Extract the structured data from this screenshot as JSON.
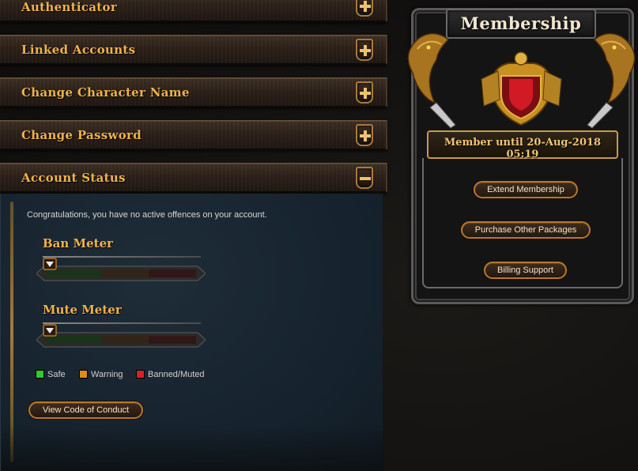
{
  "accordion": [
    {
      "label": "Authenticator",
      "state": "collapsed"
    },
    {
      "label": "Linked Accounts",
      "state": "collapsed"
    },
    {
      "label": "Change Character Name",
      "state": "collapsed"
    },
    {
      "label": "Change Password",
      "state": "collapsed"
    },
    {
      "label": "Account Status",
      "state": "expanded"
    }
  ],
  "account_status": {
    "message": "Congratulations, you have no active offences on your account.",
    "ban_meter": {
      "title": "Ban Meter",
      "level": 0
    },
    "mute_meter": {
      "title": "Mute Meter",
      "level": 0
    },
    "legend": [
      {
        "label": "Safe",
        "color": "#2fc82f"
      },
      {
        "label": "Warning",
        "color": "#e08a1a"
      },
      {
        "label": "Banned/Muted",
        "color": "#d8202a"
      }
    ],
    "conduct_button": "View Code of Conduct"
  },
  "membership": {
    "title": "Membership",
    "until": "Member until 20-Aug-2018 05:19",
    "buttons": {
      "extend": "Extend Membership",
      "purchase": "Purchase Other Packages",
      "billing": "Billing Support"
    }
  },
  "colors": {
    "accent_gold": "#f0b24a",
    "button_border": "#b7772c",
    "panel_blue": "#172430"
  },
  "icons": {
    "expand": "plus-icon",
    "collapse": "minus-icon",
    "meter_marker": "triangle-down-icon",
    "crest": "shield-crest-icon"
  }
}
